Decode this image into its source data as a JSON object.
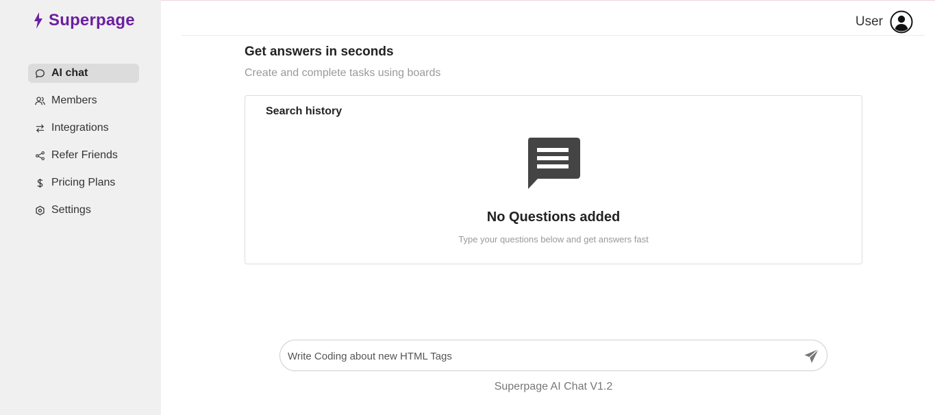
{
  "brand": {
    "name": "Superpage",
    "color": "#6b1fa0"
  },
  "sidebar": {
    "items": [
      {
        "label": "AI chat",
        "icon": "chat-bubble-icon",
        "active": true
      },
      {
        "label": "Members",
        "icon": "users-icon",
        "active": false
      },
      {
        "label": "Integrations",
        "icon": "arrows-exchange-icon",
        "active": false
      },
      {
        "label": "Refer Friends",
        "icon": "share-icon",
        "active": false
      },
      {
        "label": "Pricing Plans",
        "icon": "dollar-icon",
        "active": false
      },
      {
        "label": "Settings",
        "icon": "settings-icon",
        "active": false
      }
    ]
  },
  "header": {
    "user_label": "User"
  },
  "main": {
    "title": "Get answers in seconds",
    "subtitle": "Create and complete tasks using boards",
    "history": {
      "title": "Search history",
      "empty_title": "No Questions added",
      "empty_subtitle": "Type your questions below and get answers fast"
    },
    "chat": {
      "placeholder": "Write Coding about new HTML Tags"
    },
    "footer": "Superpage AI Chat V1.2"
  }
}
